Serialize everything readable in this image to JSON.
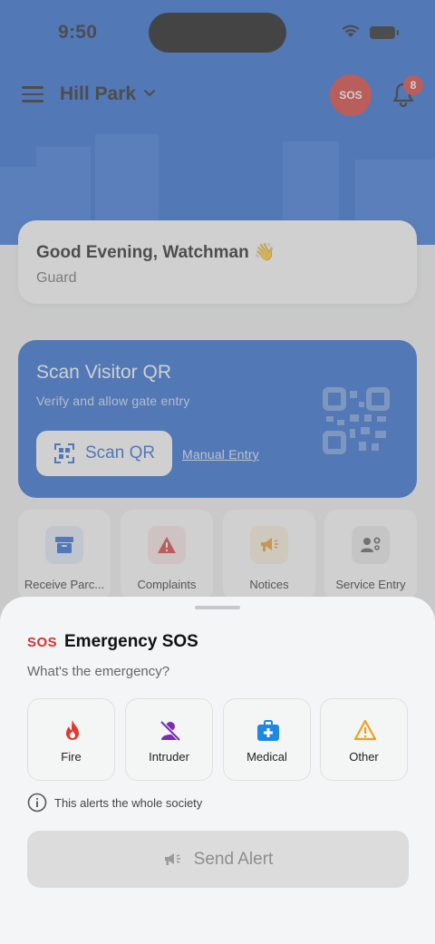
{
  "status_bar": {
    "time": "9:50"
  },
  "topbar": {
    "society_name": "Hill Park",
    "sos_label": "SOS",
    "notification_count": "8"
  },
  "greeting": {
    "title": "Good Evening, Watchman 👋",
    "role": "Guard"
  },
  "scan_card": {
    "title": "Scan Visitor QR",
    "subtitle": "Verify and allow gate entry",
    "button_label": "Scan QR",
    "manual_entry_label": "Manual Entry"
  },
  "quick_actions": [
    {
      "label": "Receive Parc...",
      "icon": "package-icon",
      "color": "#1a5fd0",
      "bg": "#e3ecfb"
    },
    {
      "label": "Complaints",
      "icon": "warning-icon",
      "color": "#d8302a",
      "bg": "#fbe6e5"
    },
    {
      "label": "Notices",
      "icon": "megaphone-icon",
      "color": "#e69a1e",
      "bg": "#fcf0dc"
    },
    {
      "label": "Service Entry",
      "icon": "service-worker-icon",
      "color": "#555555",
      "bg": "#ececec"
    }
  ],
  "sos_sheet": {
    "icon_label": "SOS",
    "title": "Emergency SOS",
    "subtitle": "What's the emergency?",
    "options": [
      {
        "label": "Fire",
        "icon": "fire-icon",
        "color": "#e0392f"
      },
      {
        "label": "Intruder",
        "icon": "intruder-icon",
        "color": "#7b2bb5"
      },
      {
        "label": "Medical",
        "icon": "medical-kit-icon",
        "color": "#1e88e5"
      },
      {
        "label": "Other",
        "icon": "warning-icon",
        "color": "#f0a01e"
      }
    ],
    "note": "This alerts the whole society",
    "send_label": "Send Alert"
  },
  "colors": {
    "brand_blue": "#1a5fd0",
    "sos_red": "#d8302a"
  }
}
